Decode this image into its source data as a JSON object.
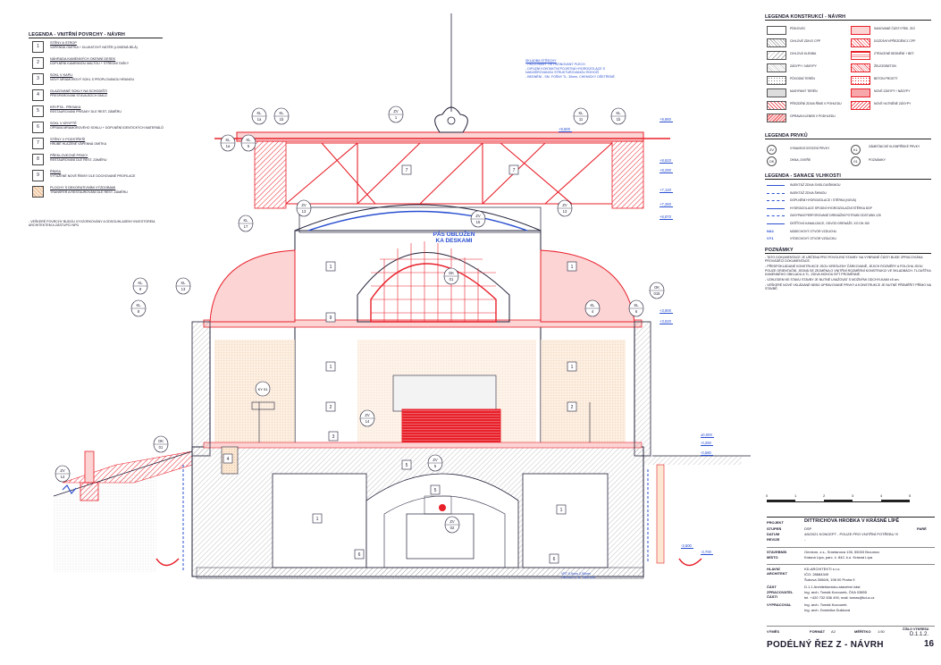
{
  "legend_left": {
    "title": "LEGENDA - VNITŘNÍ POVRCHY - NÁVRH",
    "items": [
      {
        "num": "1",
        "title": "STĚNY A STROP",
        "desc": "VÁPENNÁ OMÍTKA + DLUKATOVÝ NÁTĚR (LOMENÁ BÍLÁ)"
      },
      {
        "num": "2",
        "title": "NÁHRADA KAMENNÝCH OKENNÍ DESEK",
        "desc": "DOPLNĚNÍ KAMENNOU MALTOU + STŘEDNÍ TAŠKY"
      },
      {
        "num": "3",
        "title": "SOKL V KAPLI",
        "desc": "NOVÝ MRAMOROVÝ SOKL S PROPLOVANOU HRANOU"
      },
      {
        "num": "4",
        "title": "GLAZOVANÉ SOKLY NA SCHODIŠTI",
        "desc": "PŘESPÁROVÁNÍ STÁVAJÍCÍCH DMLŮ"
      },
      {
        "num": "5",
        "title": "KRYPTA - PRISAKA",
        "desc": "RESTAUROVÁNÍ PRISAKY DLE REST. ZÁMĚRU"
      },
      {
        "num": "6",
        "title": "SOKL V KRYPTĚ",
        "desc": "OPRAVA MRAMOROVÉHO SOKLU + DOPLNĚNÍ IDENTICKÝCH MATERIÁLŮ"
      },
      {
        "num": "7",
        "title": "STĚNY V PODSTŘEŠÍ",
        "desc": "HRUBÉ HLAZENÉ VÁPENNÁ OMÍTKA"
      },
      {
        "num": "8",
        "title": "PŘEKLOVECNÉ PRVKY",
        "desc": "RESTAUROVÁNÍ DLE REST. ZÁMĚRU"
      },
      {
        "num": "9",
        "title": "ŘÍMSA",
        "desc": "VYTAŽENÉ NOVÉ ŘÍMSY DLE DOCHOVANÉ PROFILACE"
      },
      {
        "num": "",
        "title": "PLOCHY S DEKORATIVNÍMI VÝZDOBAMI",
        "desc": "TRANSFER A RESTAUROVÁNÍ DLE REST. ZÁMĚRU"
      }
    ],
    "note": "- VEŠKERÉ POVRCHY BUDOU VYVZORKOVÁNY A ODSOUHLASENY INVESTOREM, ARCHITEKTEM A ZÁSTUPCI NPÚ"
  },
  "legend_konstrukci": {
    "title": "LEGENDA KONSTRUKCÍ - NÁVRH",
    "left": [
      "PÍSKOVEC",
      "CIHLOVÉ ZDIVO CPP",
      "CIHLOVÁ KLENBA",
      "ZÁSYPY / NÁSYPY",
      "PŮVODNÍ TERÉN",
      "NASYPANÝ TERÉN",
      "PŘEZDĚNÍ ZDIVA ŘÍMS V POHLEDU",
      "OPRAVA KLENEB V PODHLEDU"
    ],
    "right": [
      "SANOVANÉ ČÁSTI PÍSK. ZDÍ",
      "DOZDÍVKY/PŘEZDĚNÍ Z CPP",
      "ZTRACENÉ BEDNĚNÍ + BET.",
      "ŽELEZOBETON",
      "BETON PROSTÝ",
      "NOVÉ ZÁSYPY / NÁSYPY",
      "NOVÉ HUTNĚNÉ ZÁSYPY"
    ]
  },
  "legenda_prvku": {
    "title": "LEGENDA PRVKŮ",
    "items": [
      "VYBAVENÍ OSTATNÍ PRVKY",
      "OKNA, DVEŘE",
      "ZÁMEČNICKÉ KLEMPÍŘSKÉ PRVKY",
      "POZNÁMKY"
    ],
    "codes": [
      "ZV",
      "OK",
      "KL",
      "01"
    ]
  },
  "legenda_sanace": {
    "title": "LEGENDA - SANACE VLHKOSTI",
    "items": [
      "INJEKTÁŽ ZDIVA SVISLOU/ŠIKMOU",
      "INJEKTÁŽ ZDIVA ŠIKMOU",
      "DOPLNĚNÍ HYDROIZOLACE / STĚRKA (NOVÁ)",
      "HYDROIZOLACE SPODNÍ HYDROIZOLAČNÍ STĚRKA DDP",
      "ZASYPANÍ PERFOROVANÉ DRENÁŽNÍ POTRUBÍ ODSTUBN 125",
      "DEŠŤOVÁ KANALIZACE, ODVOD DRENÁŽE, KG DN 150",
      "NÁDECHOVÝ OTVOR VZDUCHU",
      "VÝDECHOVÝ OTVOR VZDUCHU"
    ],
    "codes": [
      "NA1",
      "VY1"
    ]
  },
  "poznamky": {
    "title": "POZNÁMKY",
    "items": [
      "- TATO DOKUMENTACE JE URČENA PRO POVOLENÍ STAVBY. NA VYBRANÉ ČÁSTI BUDE ZPRACOVÁNA PROVÁDĚCÍ DOKUMENTACE.",
      "- PŘEDPOKLÁDANÉ KONSTRUKCE JSOU KRESLENY ČÁRKOVANĚ, JEJICH ROZMĚRY A POLOHA JSOU POUZE ORIENTAČNÍ. JEDNÁ SE ZEJMÉNA O VNITŘNÍ ROZMĚRNÍ KONSTRUKCI VE SKLADBÁCH. TLOUŠŤKA KAMENNÉHO OBKLADU A TL. ZDIVA MOHOU BÝT PROMĚNNÉ.",
      "- VZHLEDEM KE STAVU STAVBY JE NUTNÉ UVAŽOVAT S MOŽNÝMI ODCHYLKAMI ±5 cm.",
      "- VEŠKERÉ NOVÉ VKLÁDANÉ NEBO UPRAVOVANÉ PRVKY A KONSTRUKCE JE NUTNÉ PŘEMĚŘIT PŘÍMO NA STAVBĚ."
    ]
  },
  "scale_bar": [
    "0",
    "1",
    "2",
    "3",
    "4",
    "5"
  ],
  "title_block": {
    "projekt_label": "PROJEKT",
    "projekt": "DITTRICHOVA HROBKA V KRÁSNÉ LÍPĚ",
    "stupen_label": "STUPEŇ",
    "stupen": "DSP",
    "pare": "PARÉ",
    "datum_label": "DATUM",
    "datum": "4/6/2021 KONCEPT - POUZE PRO VNITŘNÍ POTŘEBU !!!",
    "revize_label": "REVIZE",
    "revize": "-",
    "stavebnik_label": "STAVEBNÍK",
    "stavebnik": "Omnium, z.s., Smetanova 135, 55003 Broumov",
    "misto_label": "MÍSTO",
    "misto": "Krásná Lípa, parc. č. 842, k.ú. Krásná Lípa",
    "hlavni_label": "HLAVNÍ ARCHITEKT",
    "hlavni": [
      "KD-ARCHITEKTI s.r.o.",
      "IČO: 28684349",
      "Šubova 3066/6, 198 00 Praha 9"
    ],
    "cast_label": "ČÁST",
    "cast": "D.1.1 Architektonicko-stavební část",
    "zpracovatel_label": "ZPRACOVATEL ČÁSTI",
    "zpracovatel": [
      "Ing. arch. Tomáš Kocourek, ČKA 03855",
      "tel. +420 732 836 490, mail: tomas@kd-a.cz"
    ],
    "vypracoval_label": "VYPRACOVAL",
    "vypracoval": [
      "Ing. arch. Tomáš Kocourek",
      "Ing. arch. Dominika Dušková"
    ],
    "vymes_label": "VÝMĚS",
    "format_label": "FORMÁT",
    "format": "A2",
    "meritko_label": "MĚŘÍTKO",
    "meritko": "1:50",
    "cislo_label": "ČÍSLO VÝKRESU",
    "cislo": "D.1.1.2.",
    "sheet_title": "PODÉLNÝ ŘEZ Z - NÁVRH",
    "sheet_no": "16"
  },
  "annotations": {
    "roof_note": [
      "SKLADBA STŘECHY",
      "- FALCOVANÝ TŘÍ PATINOVANÝ PLECH",
      "- DIFÚZNÍ KONTAKTNÍ POJISTNÁ HYDROIZOLACE S NAKAŠÍROVANOU STRUKTUROVANOU ROHOŽÍ",
      "- BEDNĚNÍ - SM. FOŠNY TL. 30mm, CHEMICKY OŠETŘENÉ"
    ],
    "pas_obloz": [
      "PÁS OBLOŽEN",
      "KA DESKAMI"
    ],
    "levels": [
      "+9,860",
      "+9,600",
      "+8,620",
      "+8,290",
      "+7,120",
      "+7,260",
      "+6,870",
      "+3,900",
      "+3,520",
      "±0,000",
      "-0,250",
      "-0,580",
      "-3,600",
      "-3,700"
    ],
    "bottom_note": [
      "VRT 0,5mm 2,55mm",
      "DÉLKA 0,7 B. 15x6 mm"
    ],
    "ky01": "KY 01",
    "sokl": "ŘÍMSA"
  },
  "tags": {
    "kl": [
      [
        "KL",
        "1a"
      ],
      [
        "KL",
        "1b"
      ],
      [
        "KL",
        "1b"
      ],
      [
        "KL",
        "11"
      ],
      [
        "KL",
        "1a"
      ],
      [
        "KL",
        "5"
      ],
      [
        "KL",
        "17"
      ],
      [
        "KL",
        "9"
      ],
      [
        "KL",
        "8"
      ],
      [
        "KL",
        "13"
      ],
      [
        "KL",
        "4"
      ],
      [
        "KL",
        "6"
      ]
    ],
    "zv": [
      [
        "ZV",
        "1"
      ],
      [
        "ZV",
        "13"
      ],
      [
        "ZV",
        "15"
      ],
      [
        "ZV",
        "13"
      ],
      [
        "ZV",
        "14"
      ],
      [
        "ZV",
        "5"
      ],
      [
        "ZV",
        "02"
      ],
      [
        "ZV",
        "14"
      ]
    ],
    "ok": [
      [
        "OK",
        "01"
      ],
      [
        "OK",
        "015"
      ],
      [
        "OK",
        "01"
      ]
    ]
  },
  "colors": {
    "ink": "#22223a",
    "red": "#e8202a",
    "pink": "#f7b8b8",
    "blue": "#2a4fd1",
    "sand": "#f0c8a0"
  }
}
